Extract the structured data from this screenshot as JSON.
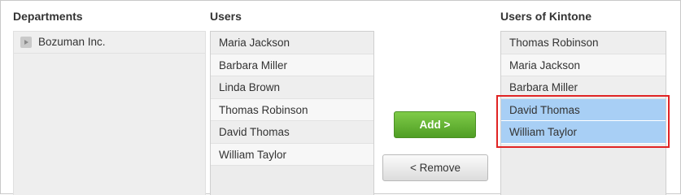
{
  "departments": {
    "title": "Departments",
    "items": [
      {
        "label": "Bozuman Inc.",
        "icon": "expand-arrow-icon"
      }
    ]
  },
  "users": {
    "title": "Users",
    "items": [
      "Maria Jackson",
      "Barbara Miller",
      "Linda Brown",
      "Thomas Robinson",
      "David Thomas",
      "William Taylor"
    ]
  },
  "actions": {
    "add_label": "Add >",
    "remove_label": "< Remove"
  },
  "kintone_users": {
    "title": "Users of Kintone",
    "items": [
      {
        "label": "Thomas Robinson",
        "selected": false
      },
      {
        "label": "Maria Jackson",
        "selected": false
      },
      {
        "label": "Barbara Miller",
        "selected": false
      },
      {
        "label": "David Thomas",
        "selected": true
      },
      {
        "label": "William Taylor",
        "selected": true
      }
    ]
  },
  "colors": {
    "selection": "#a8cff5",
    "add_button": "#5fae2e",
    "highlight": "#e02424"
  }
}
